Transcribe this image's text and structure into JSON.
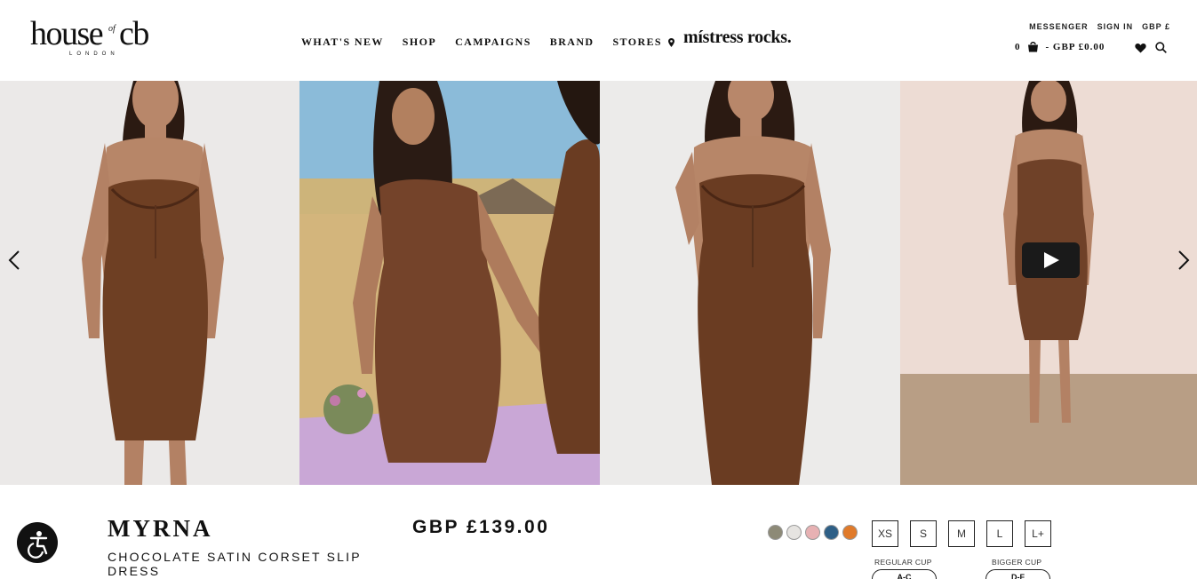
{
  "header": {
    "logo_text": "house of cb",
    "logo_sub": "LONDON",
    "nav": [
      "WHAT'S NEW",
      "SHOP",
      "CAMPAIGNS",
      "BRAND",
      "STORES"
    ],
    "campaign_logo": "místress rocks.",
    "utility": [
      "MESSENGER",
      "SIGN IN",
      "GBP £"
    ],
    "cart_count": "0",
    "cart_total": "- GBP £0.00"
  },
  "gallery": {
    "slides": [
      {
        "label": "product-photo-front",
        "backdrop": "#ebe9e8",
        "dress": "#6e3f23"
      },
      {
        "label": "product-photo-field",
        "backdrop": "#cdb47a",
        "dress": "#74432a"
      },
      {
        "label": "product-photo-pose",
        "backdrop": "#ecebea",
        "dress": "#6a3c22"
      },
      {
        "label": "product-video",
        "backdrop": "#eddcd4",
        "dress": "#6f4128"
      }
    ]
  },
  "product": {
    "name": "MYRNA",
    "description": "CHOCOLATE SATIN CORSET SLIP DRESS",
    "price": "GBP £139.00",
    "swatches": [
      "#8d8a77",
      "#e6e4e1",
      "#e7b1b3",
      "#2e5f86",
      "#e07a2a"
    ],
    "sizes": [
      "XS",
      "S",
      "M",
      "L",
      "L+"
    ],
    "cups": [
      {
        "label": "REGULAR CUP",
        "value": "A-C"
      },
      {
        "label": "BIGGER CUP",
        "value": "D-F"
      }
    ]
  }
}
